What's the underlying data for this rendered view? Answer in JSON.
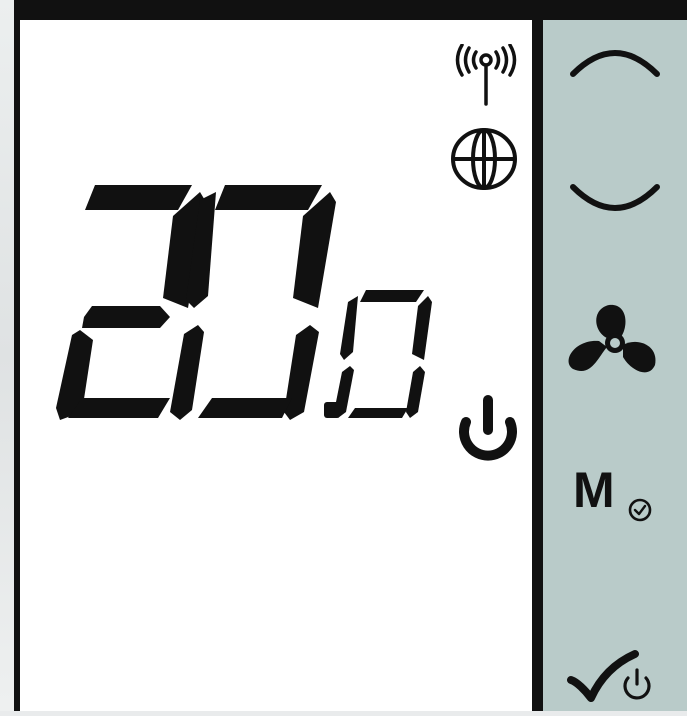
{
  "display": {
    "temperature_integer": "20",
    "temperature_decimal": "0",
    "status_icons": [
      "wireless-signal-icon",
      "globe-icon",
      "power-icon"
    ]
  },
  "controls": {
    "buttons": [
      {
        "name": "temperature-up-button",
        "icon": "chevron-up-icon"
      },
      {
        "name": "temperature-down-button",
        "icon": "chevron-down-icon"
      },
      {
        "name": "fan-speed-button",
        "icon": "fan-icon"
      },
      {
        "name": "mode-schedule-button",
        "icon": "clock-icon",
        "label": "M"
      },
      {
        "name": "confirm-power-button",
        "icon": "check-power-icon"
      }
    ]
  },
  "colors": {
    "screen_background": "#ffffff",
    "panel_background": "#b9cbc9",
    "frame": "#111111",
    "segments": "#111111"
  }
}
